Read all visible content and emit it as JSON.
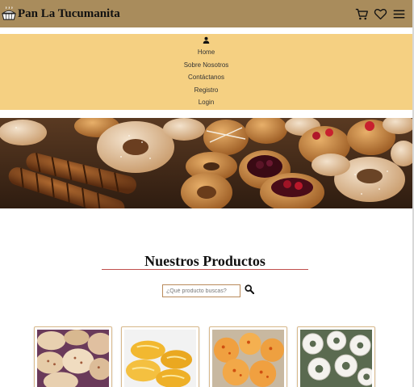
{
  "header": {
    "title": "Pan La Tucumanita",
    "logo_icon": "bread-basket-icon",
    "icons": [
      "cart-icon",
      "heart-icon",
      "menu-icon"
    ]
  },
  "menu": {
    "user_icon": "user-icon",
    "items": [
      {
        "label": "Home"
      },
      {
        "label": "Sobre Nosotros"
      },
      {
        "label": "Contáctanos"
      },
      {
        "label": "Registro"
      },
      {
        "label": "Login"
      }
    ]
  },
  "products_section": {
    "title": "Nuestros Productos",
    "search_placeholder": "¿Qué producto buscas?",
    "search_icon": "search-icon"
  },
  "colors": {
    "header_bg": "#a98c5c",
    "menu_bg": "#f5d082",
    "title_underline": "#c0504d"
  }
}
